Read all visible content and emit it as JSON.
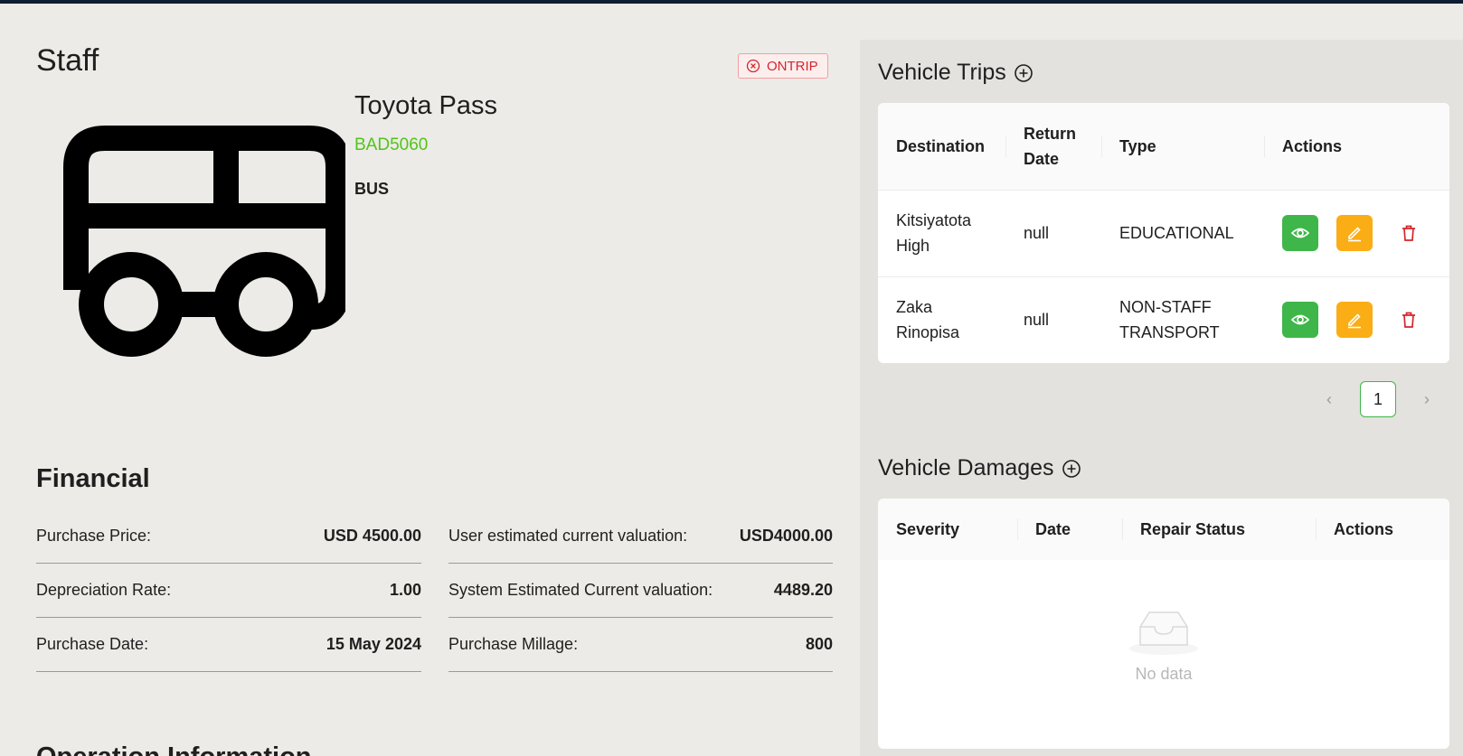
{
  "page": {
    "title": "Staff"
  },
  "status_tag": {
    "label": "ONTRIP",
    "color": "#d4252b"
  },
  "vehicle": {
    "name": "Toyota Pass",
    "plate": "BAD5060",
    "type": "BUS",
    "icon": "bus-icon",
    "plate_color": "#52c41a"
  },
  "financial": {
    "title": "Financial",
    "rows": [
      {
        "label": "Purchase Price:",
        "value": "USD 4500.00"
      },
      {
        "label": "User estimated current valuation:",
        "value": "USD4000.00"
      },
      {
        "label": "Depreciation Rate:",
        "value": "1.00"
      },
      {
        "label": "System Estimated Current valuation:",
        "value": "4489.20"
      },
      {
        "label": "Purchase Date:",
        "value": "15 May 2024"
      },
      {
        "label": "Purchase Millage:",
        "value": "800"
      }
    ]
  },
  "operation": {
    "title": "Operation Information"
  },
  "trips": {
    "title": "Vehicle Trips",
    "add_icon": "plus-circle-icon",
    "columns": [
      "Destination",
      "Return Date",
      "Type",
      "Actions"
    ],
    "rows": [
      {
        "destination": "Kitsiyatota High",
        "return_date": "null",
        "type": "EDUCATIONAL"
      },
      {
        "destination": "Zaka Rinopisa",
        "return_date": "null",
        "type": "NON-STAFF TRANSPORT"
      }
    ],
    "pagination": {
      "prev": "‹",
      "current": "1",
      "next": "›"
    }
  },
  "damages": {
    "title": "Vehicle Damages",
    "add_icon": "plus-circle-icon",
    "columns": [
      "Severity",
      "Date",
      "Repair Status",
      "Actions"
    ],
    "empty_text": "No data",
    "empty_icon": "inbox-icon"
  },
  "colors": {
    "accent_green": "#3fb64a",
    "edit_orange": "#faad14",
    "danger_red": "#d4252b",
    "topbar": "#0f1d33"
  }
}
